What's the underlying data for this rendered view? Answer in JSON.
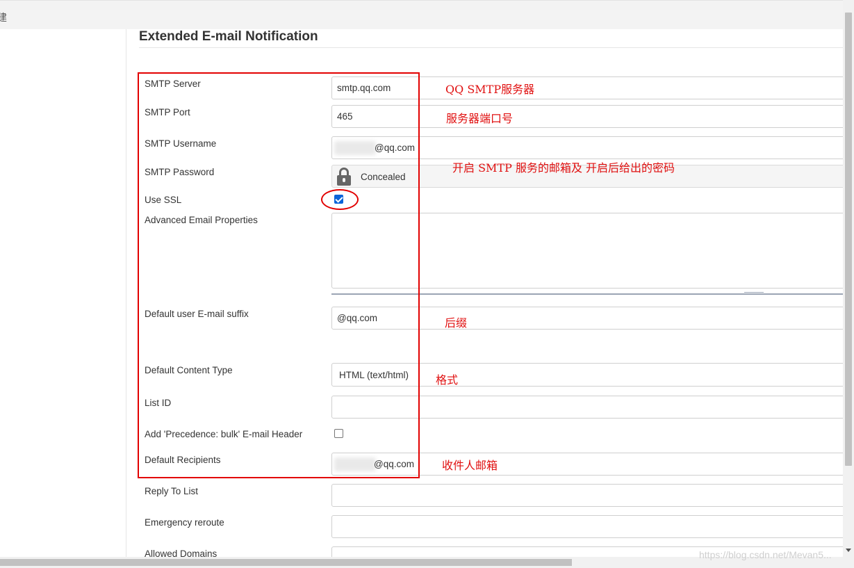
{
  "topbar": {
    "fragment": "建"
  },
  "section": {
    "title": "Extended E-mail Notification"
  },
  "fields": {
    "smtp_server": {
      "label": "SMTP Server",
      "value": "smtp.qq.com"
    },
    "smtp_port": {
      "label": "SMTP Port",
      "value": "465"
    },
    "smtp_username": {
      "label": "SMTP Username",
      "value": "@qq.com"
    },
    "smtp_password": {
      "label": "SMTP Password",
      "value": "Concealed"
    },
    "use_ssl": {
      "label": "Use SSL",
      "checked": true
    },
    "advanced_email_properties": {
      "label": "Advanced Email Properties",
      "value": ""
    },
    "default_user_email_suffix": {
      "label": "Default user E-mail suffix",
      "value": "@qq.com"
    },
    "default_content_type": {
      "label": "Default Content Type",
      "value": "HTML (text/html)"
    },
    "list_id": {
      "label": "List ID",
      "value": ""
    },
    "precedence_bulk_header": {
      "label": "Add 'Precedence: bulk' E-mail Header",
      "checked": false
    },
    "default_recipients": {
      "label": "Default Recipients",
      "value": "@qq.com"
    },
    "reply_to_list": {
      "label": "Reply To List",
      "value": ""
    },
    "emergency_reroute": {
      "label": "Emergency reroute",
      "value": ""
    },
    "allowed_domains": {
      "label": "Allowed Domains",
      "value": ""
    }
  },
  "annotations": {
    "smtp_server": "QQ SMTP服务器",
    "smtp_port": "服务器端口号",
    "credentials": "开启 SMTP 服务的邮箱及 开启后给出的密码",
    "suffix": "后缀",
    "format": "格式",
    "recipients": "收件人邮箱"
  },
  "watermark": "https://blog.csdn.net/Mevan5...",
  "colors": {
    "annotation": "#e20000",
    "checkbox_checked": "#0b64d8"
  },
  "icons": {
    "password": "lock-icon"
  }
}
